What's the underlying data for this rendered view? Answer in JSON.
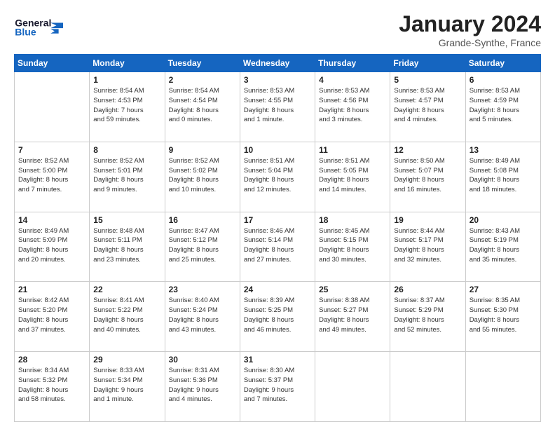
{
  "header": {
    "logo_text_general": "General",
    "logo_text_blue": "Blue",
    "title": "January 2024",
    "subtitle": "Grande-Synthe, France"
  },
  "days_of_week": [
    "Sunday",
    "Monday",
    "Tuesday",
    "Wednesday",
    "Thursday",
    "Friday",
    "Saturday"
  ],
  "weeks": [
    [
      {
        "day": "",
        "info": ""
      },
      {
        "day": "1",
        "info": "Sunrise: 8:54 AM\nSunset: 4:53 PM\nDaylight: 7 hours\nand 59 minutes."
      },
      {
        "day": "2",
        "info": "Sunrise: 8:54 AM\nSunset: 4:54 PM\nDaylight: 8 hours\nand 0 minutes."
      },
      {
        "day": "3",
        "info": "Sunrise: 8:53 AM\nSunset: 4:55 PM\nDaylight: 8 hours\nand 1 minute."
      },
      {
        "day": "4",
        "info": "Sunrise: 8:53 AM\nSunset: 4:56 PM\nDaylight: 8 hours\nand 3 minutes."
      },
      {
        "day": "5",
        "info": "Sunrise: 8:53 AM\nSunset: 4:57 PM\nDaylight: 8 hours\nand 4 minutes."
      },
      {
        "day": "6",
        "info": "Sunrise: 8:53 AM\nSunset: 4:59 PM\nDaylight: 8 hours\nand 5 minutes."
      }
    ],
    [
      {
        "day": "7",
        "info": "Sunrise: 8:52 AM\nSunset: 5:00 PM\nDaylight: 8 hours\nand 7 minutes."
      },
      {
        "day": "8",
        "info": "Sunrise: 8:52 AM\nSunset: 5:01 PM\nDaylight: 8 hours\nand 9 minutes."
      },
      {
        "day": "9",
        "info": "Sunrise: 8:52 AM\nSunset: 5:02 PM\nDaylight: 8 hours\nand 10 minutes."
      },
      {
        "day": "10",
        "info": "Sunrise: 8:51 AM\nSunset: 5:04 PM\nDaylight: 8 hours\nand 12 minutes."
      },
      {
        "day": "11",
        "info": "Sunrise: 8:51 AM\nSunset: 5:05 PM\nDaylight: 8 hours\nand 14 minutes."
      },
      {
        "day": "12",
        "info": "Sunrise: 8:50 AM\nSunset: 5:07 PM\nDaylight: 8 hours\nand 16 minutes."
      },
      {
        "day": "13",
        "info": "Sunrise: 8:49 AM\nSunset: 5:08 PM\nDaylight: 8 hours\nand 18 minutes."
      }
    ],
    [
      {
        "day": "14",
        "info": "Sunrise: 8:49 AM\nSunset: 5:09 PM\nDaylight: 8 hours\nand 20 minutes."
      },
      {
        "day": "15",
        "info": "Sunrise: 8:48 AM\nSunset: 5:11 PM\nDaylight: 8 hours\nand 23 minutes."
      },
      {
        "day": "16",
        "info": "Sunrise: 8:47 AM\nSunset: 5:12 PM\nDaylight: 8 hours\nand 25 minutes."
      },
      {
        "day": "17",
        "info": "Sunrise: 8:46 AM\nSunset: 5:14 PM\nDaylight: 8 hours\nand 27 minutes."
      },
      {
        "day": "18",
        "info": "Sunrise: 8:45 AM\nSunset: 5:15 PM\nDaylight: 8 hours\nand 30 minutes."
      },
      {
        "day": "19",
        "info": "Sunrise: 8:44 AM\nSunset: 5:17 PM\nDaylight: 8 hours\nand 32 minutes."
      },
      {
        "day": "20",
        "info": "Sunrise: 8:43 AM\nSunset: 5:19 PM\nDaylight: 8 hours\nand 35 minutes."
      }
    ],
    [
      {
        "day": "21",
        "info": "Sunrise: 8:42 AM\nSunset: 5:20 PM\nDaylight: 8 hours\nand 37 minutes."
      },
      {
        "day": "22",
        "info": "Sunrise: 8:41 AM\nSunset: 5:22 PM\nDaylight: 8 hours\nand 40 minutes."
      },
      {
        "day": "23",
        "info": "Sunrise: 8:40 AM\nSunset: 5:24 PM\nDaylight: 8 hours\nand 43 minutes."
      },
      {
        "day": "24",
        "info": "Sunrise: 8:39 AM\nSunset: 5:25 PM\nDaylight: 8 hours\nand 46 minutes."
      },
      {
        "day": "25",
        "info": "Sunrise: 8:38 AM\nSunset: 5:27 PM\nDaylight: 8 hours\nand 49 minutes."
      },
      {
        "day": "26",
        "info": "Sunrise: 8:37 AM\nSunset: 5:29 PM\nDaylight: 8 hours\nand 52 minutes."
      },
      {
        "day": "27",
        "info": "Sunrise: 8:35 AM\nSunset: 5:30 PM\nDaylight: 8 hours\nand 55 minutes."
      }
    ],
    [
      {
        "day": "28",
        "info": "Sunrise: 8:34 AM\nSunset: 5:32 PM\nDaylight: 8 hours\nand 58 minutes."
      },
      {
        "day": "29",
        "info": "Sunrise: 8:33 AM\nSunset: 5:34 PM\nDaylight: 9 hours\nand 1 minute."
      },
      {
        "day": "30",
        "info": "Sunrise: 8:31 AM\nSunset: 5:36 PM\nDaylight: 9 hours\nand 4 minutes."
      },
      {
        "day": "31",
        "info": "Sunrise: 8:30 AM\nSunset: 5:37 PM\nDaylight: 9 hours\nand 7 minutes."
      },
      {
        "day": "",
        "info": ""
      },
      {
        "day": "",
        "info": ""
      },
      {
        "day": "",
        "info": ""
      }
    ]
  ]
}
